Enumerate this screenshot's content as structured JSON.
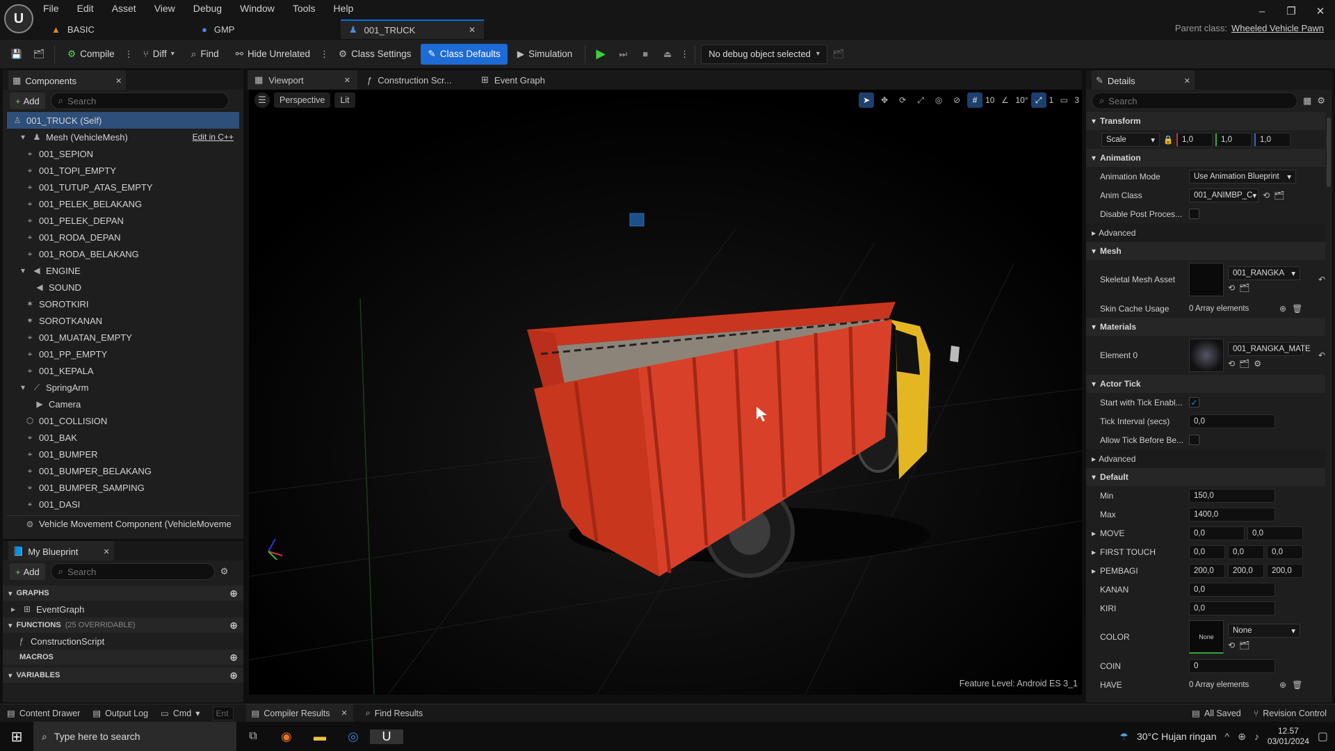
{
  "menu": [
    "File",
    "Edit",
    "Asset",
    "View",
    "Debug",
    "Window",
    "Tools",
    "Help"
  ],
  "doc_tabs": [
    {
      "label": "BASIC",
      "icon": "level-icon"
    },
    {
      "label": "GMP",
      "icon": "material-icon"
    },
    {
      "label": "001_TRUCK",
      "icon": "blueprint-icon",
      "active": true
    }
  ],
  "parent_class": {
    "label": "Parent class:",
    "value": "Wheeled Vehicle Pawn"
  },
  "toolbar": {
    "compile": "Compile",
    "diff": "Diff",
    "find": "Find",
    "hide_unrelated": "Hide Unrelated",
    "class_settings": "Class Settings",
    "class_defaults": "Class Defaults",
    "simulation": "Simulation",
    "debug_object": "No debug object selected"
  },
  "components": {
    "tab": "Components",
    "add": "Add",
    "search_placeholder": "Search",
    "self": "001_TRUCK (Self)",
    "mesh": "Mesh (VehicleMesh)",
    "edit_cpp": "Edit in C++",
    "items": [
      {
        "label": "001_SEPION",
        "indent": 2,
        "icon": "bone-icon"
      },
      {
        "label": "001_TOPI_EMPTY",
        "indent": 2,
        "icon": "bone-icon"
      },
      {
        "label": "001_TUTUP_ATAS_EMPTY",
        "indent": 2,
        "icon": "bone-icon"
      },
      {
        "label": "001_PELEK_BELAKANG",
        "indent": 2,
        "icon": "bone-icon"
      },
      {
        "label": "001_PELEK_DEPAN",
        "indent": 2,
        "icon": "bone-icon"
      },
      {
        "label": "001_RODA_DEPAN",
        "indent": 2,
        "icon": "bone-icon"
      },
      {
        "label": "001_RODA_BELAKANG",
        "indent": 2,
        "icon": "bone-icon"
      },
      {
        "label": "ENGINE",
        "indent": 2,
        "icon": "speaker-icon",
        "expander": true
      },
      {
        "label": "SOUND",
        "indent": 3,
        "icon": "speaker-icon"
      },
      {
        "label": "SOROTKIRI",
        "indent": 2,
        "icon": "spotlight-icon"
      },
      {
        "label": "SOROTKANAN",
        "indent": 2,
        "icon": "spotlight-icon"
      },
      {
        "label": "001_MUATAN_EMPTY",
        "indent": 2,
        "icon": "bone-icon"
      },
      {
        "label": "001_PP_EMPTY",
        "indent": 2,
        "icon": "bone-icon"
      },
      {
        "label": "001_KEPALA",
        "indent": 2,
        "icon": "bone-icon"
      },
      {
        "label": "SpringArm",
        "indent": 2,
        "icon": "springarm-icon",
        "expander": true
      },
      {
        "label": "Camera",
        "indent": 3,
        "icon": "camera-icon"
      },
      {
        "label": "001_COLLISION",
        "indent": 2,
        "icon": "collision-icon"
      },
      {
        "label": "001_BAK",
        "indent": 2,
        "icon": "bone-icon"
      },
      {
        "label": "001_BUMPER",
        "indent": 2,
        "icon": "bone-icon"
      },
      {
        "label": "001_BUMPER_BELAKANG",
        "indent": 2,
        "icon": "bone-icon"
      },
      {
        "label": "001_BUMPER_SAMPING",
        "indent": 2,
        "icon": "bone-icon"
      },
      {
        "label": "001_DASI",
        "indent": 2,
        "icon": "bone-icon"
      }
    ],
    "movement": "Vehicle Movement Component (VehicleMoveme"
  },
  "my_blueprint": {
    "tab": "My Blueprint",
    "add": "Add",
    "search_placeholder": "Search",
    "graphs": "GRAPHS",
    "event_graph": "EventGraph",
    "functions": "FUNCTIONS",
    "functions_note": "(25 OVERRIDABLE)",
    "construction_script": "ConstructionScript",
    "macros": "MACROS",
    "variables": "VARIABLES"
  },
  "editor_tabs": [
    {
      "label": "Viewport",
      "active": true
    },
    {
      "label": "Construction Scr..."
    },
    {
      "label": "Event Graph"
    }
  ],
  "viewport": {
    "perspective": "Perspective",
    "lit": "Lit",
    "grid_size": "10",
    "rot_snap": "10°",
    "scale_snap": "1",
    "cam_speed": "3",
    "feature_level": "Feature Level:  Android ES 3_1"
  },
  "details": {
    "tab": "Details",
    "search_placeholder": "Search",
    "transform": "Transform",
    "scale_mode": "Scale",
    "scale": [
      "1,0",
      "1,0",
      "1,0"
    ],
    "animation": "Animation",
    "anim_mode_label": "Animation Mode",
    "anim_mode": "Use Animation Blueprint",
    "anim_class_label": "Anim Class",
    "anim_class": "001_ANIMBP_C",
    "disable_post_label": "Disable Post Proces...",
    "advanced": "Advanced",
    "mesh": "Mesh",
    "skeletal_label": "Skeletal Mesh Asset",
    "skeletal": "001_RANGKA",
    "skin_cache_label": "Skin Cache Usage",
    "skin_cache": "0 Array elements",
    "materials": "Materials",
    "element0_label": "Element 0",
    "element0": "001_RANGKA_MATE",
    "actor_tick": "Actor Tick",
    "start_tick_label": "Start with Tick Enabl...",
    "tick_interval_label": "Tick Interval (secs)",
    "tick_interval": "0,0",
    "allow_tick_label": "Allow Tick Before Be...",
    "default": "Default",
    "min_label": "Min",
    "min": "150,0",
    "max_label": "Max",
    "max": "1400,0",
    "move_label": "MOVE",
    "move": [
      "0,0",
      "0,0"
    ],
    "first_touch_label": "FIRST TOUCH",
    "first_touch": [
      "0,0",
      "0,0",
      "0,0"
    ],
    "pembagi_label": "PEMBAGI",
    "pembagi": [
      "200,0",
      "200,0",
      "200,0"
    ],
    "kanan_label": "KANAN",
    "kanan": "0,0",
    "kiri_label": "KIRI",
    "kiri": "0,0",
    "color_label": "COLOR",
    "color_thumb": "None",
    "color_value": "None",
    "coin_label": "COIN",
    "coin": "0",
    "have_label": "HAVE",
    "have": "0 Array elements"
  },
  "statusbar": {
    "content_drawer": "Content Drawer",
    "output_log": "Output Log",
    "cmd": "Cmd",
    "cmd_placeholder": "Ent",
    "compiler_results": "Compiler Results",
    "find_results": "Find Results",
    "all_saved": "All Saved",
    "revision_control": "Revision Control"
  },
  "taskbar": {
    "search_placeholder": "Type here to search",
    "weather": "30°C  Hujan ringan",
    "time": "12.57",
    "date": "03/01/2024"
  },
  "colors": {
    "accent": "#1d6bd4",
    "truck_body": "#d8402a",
    "truck_cab": "#e8b820"
  }
}
